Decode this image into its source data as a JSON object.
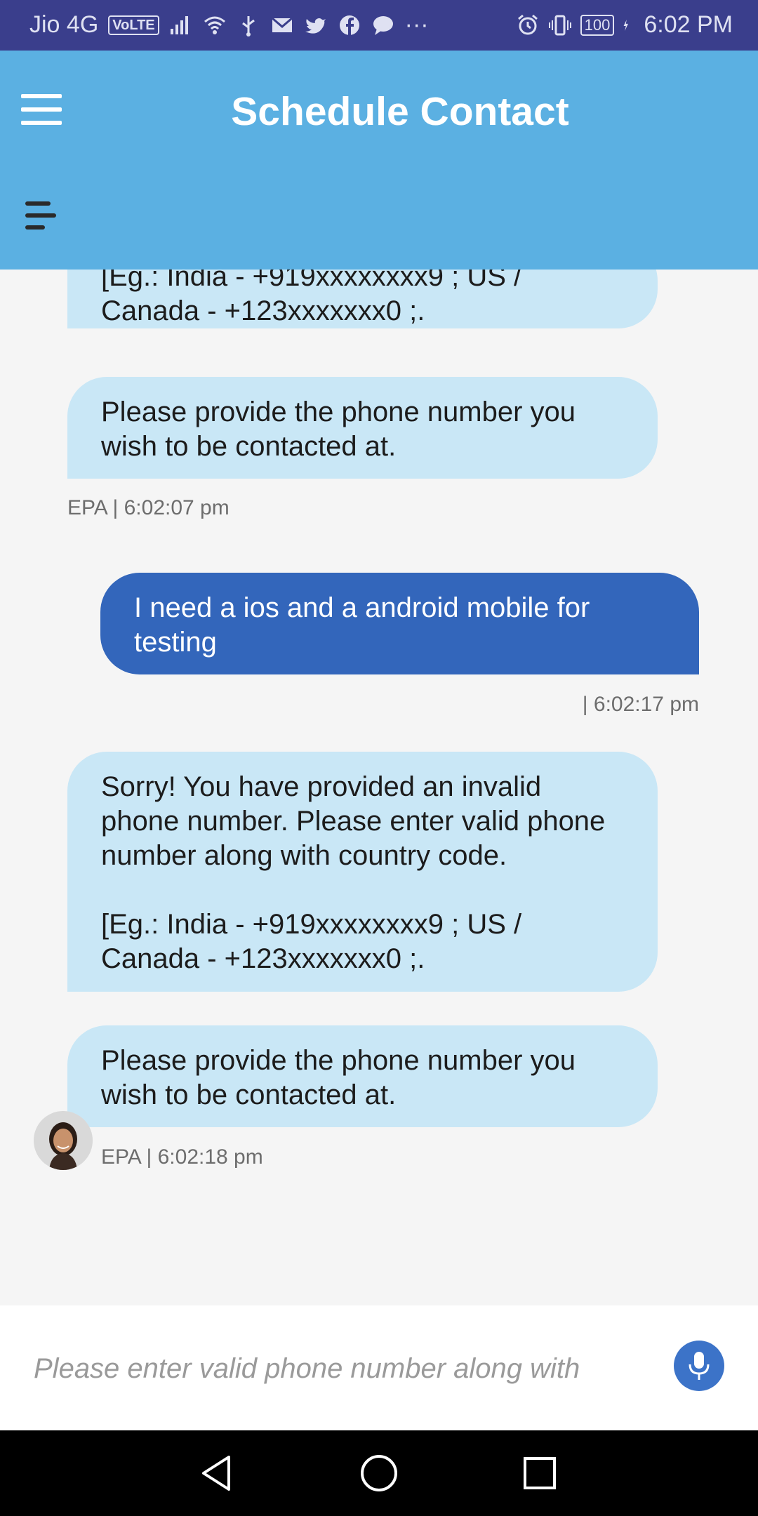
{
  "status_bar": {
    "carrier": "Jio 4G",
    "volte": "VoLTE",
    "battery": "100",
    "time": "6:02 PM",
    "overflow": "···"
  },
  "app_bar": {
    "title": "Schedule Contact"
  },
  "messages": [
    {
      "sender": "bot",
      "line1": "[Eg.: India - +919xxxxxxxx9 ; US /",
      "line2": "Canada - +123xxxxxxx0 ;."
    },
    {
      "sender": "bot",
      "line1": "Please provide the phone number you",
      "line2": "wish to be contacted at.",
      "meta": "EPA | 6:02:07 pm"
    },
    {
      "sender": "user",
      "line1": "I need a ios and a android mobile for",
      "line2": "testing",
      "meta": "| 6:02:17 pm"
    },
    {
      "sender": "bot",
      "line1": "Sorry! You have provided an invalid",
      "line2": "phone number. Please enter valid phone",
      "line3": "number along with country code.",
      "line4": "[Eg.: India - +919xxxxxxxx9 ; US /",
      "line5": "Canada - +123xxxxxxx0 ;."
    },
    {
      "sender": "bot",
      "line1": "Please provide the phone number you",
      "line2": "wish to be contacted at.",
      "meta": "EPA | 6:02:18 pm"
    }
  ],
  "input": {
    "placeholder": "Please enter valid phone number along with"
  },
  "icons": {
    "menu": "hamburger-icon",
    "menu_secondary": "menu-lines-icon",
    "mic": "microphone-icon",
    "back": "back-triangle-icon",
    "home": "home-circle-icon",
    "recents": "recents-square-icon"
  },
  "colors": {
    "status_bar": "#3a3e8c",
    "app_bar": "#5bb0e2",
    "bot_bubble": "#c9e7f6",
    "user_bubble": "#3366bb",
    "mic_button": "#3c73c8"
  }
}
